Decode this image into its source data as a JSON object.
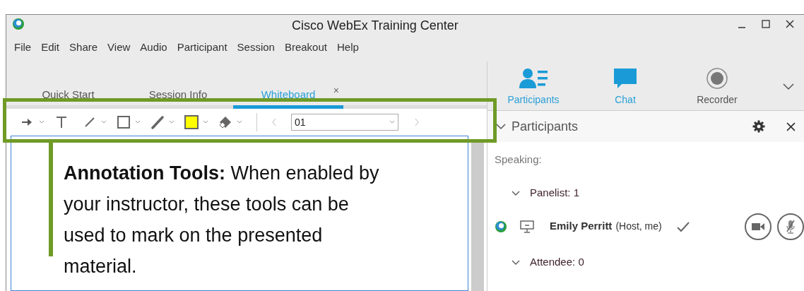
{
  "window": {
    "title": "Cisco WebEx Training Center"
  },
  "menu": [
    {
      "label": "File"
    },
    {
      "label": "Edit"
    },
    {
      "label": "Share"
    },
    {
      "label": "View"
    },
    {
      "label": "Audio"
    },
    {
      "label": "Participant"
    },
    {
      "label": "Session"
    },
    {
      "label": "Breakout"
    },
    {
      "label": "Help"
    }
  ],
  "tabs": [
    {
      "label": "Quick Start",
      "selected": false
    },
    {
      "label": "Session Info",
      "selected": false
    },
    {
      "label": "Whiteboard",
      "selected": true,
      "close": "×"
    }
  ],
  "toolbar": {
    "tools": [
      {
        "kind": "arrow",
        "dropdown": true
      },
      {
        "kind": "text",
        "dropdown": false
      },
      {
        "kind": "line",
        "dropdown": true
      },
      {
        "kind": "rectangle",
        "dropdown": true
      },
      {
        "kind": "pen",
        "dropdown": true
      },
      {
        "kind": "color",
        "dropdown": true,
        "color": "#ffff00"
      },
      {
        "kind": "eraser",
        "dropdown": true
      }
    ],
    "page": "01"
  },
  "callout": "**Annotation Tools:** When enabled by your instructor, these tools can be used to mark on the presented material.",
  "panel_tabs": [
    {
      "label": "Participants",
      "kind": "participants",
      "selected": true
    },
    {
      "label": "Chat",
      "kind": "chat",
      "selected": true
    },
    {
      "label": "Recorder",
      "kind": "recorder",
      "selected": false
    }
  ],
  "participants": {
    "title": "Participants",
    "speaking": "Speaking:",
    "groups": [
      {
        "label": "Panelist: 1",
        "expanded": true,
        "members": [
          {
            "name": "Emily Perritt",
            "role": "(Host, me)"
          }
        ]
      },
      {
        "label": "Attendee: 0",
        "expanded": true
      }
    ]
  }
}
